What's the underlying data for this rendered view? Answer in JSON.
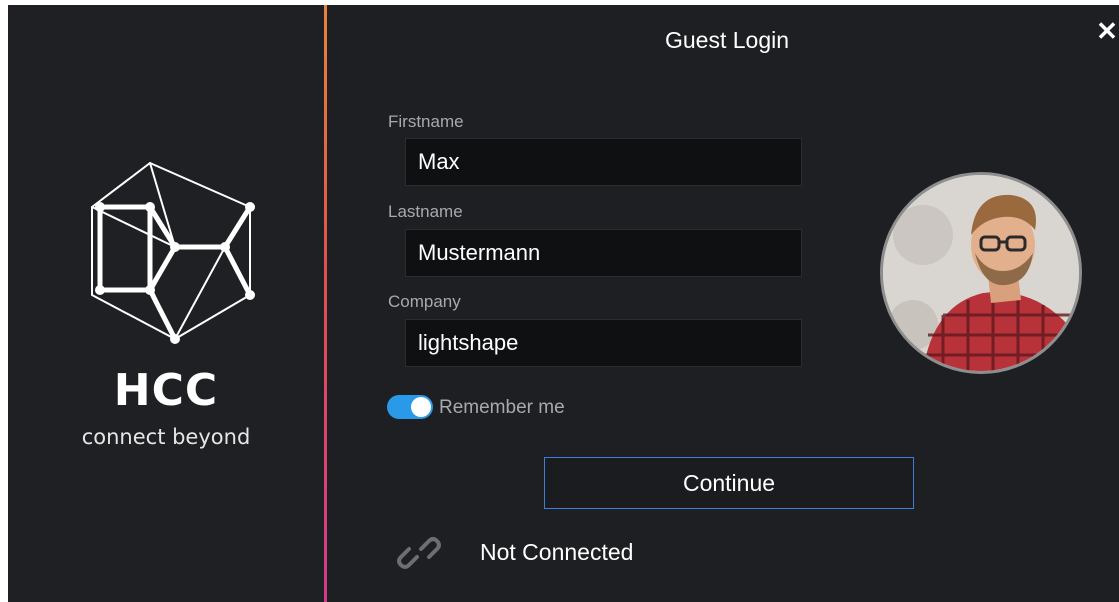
{
  "brand": {
    "name": "HCC",
    "tagline": "connect beyond"
  },
  "dialog": {
    "title": "Guest Login",
    "close_label": "✕"
  },
  "form": {
    "firstname": {
      "label": "Firstname",
      "value": "Max"
    },
    "lastname": {
      "label": "Lastname",
      "value": "Mustermann"
    },
    "company": {
      "label": "Company",
      "value": "lightshape"
    },
    "remember_me": {
      "label": "Remember me",
      "checked": true
    }
  },
  "actions": {
    "continue_label": "Continue"
  },
  "status": {
    "connection_text": "Not Connected",
    "icon": "link-icon"
  },
  "avatar": {
    "icon": "user-photo"
  },
  "colors": {
    "background": "#1e1f22",
    "accent_blue": "#2a9ae8",
    "divider_top": "#e8843a",
    "divider_bottom": "#d43a8c",
    "button_border": "#3d7fd6"
  }
}
